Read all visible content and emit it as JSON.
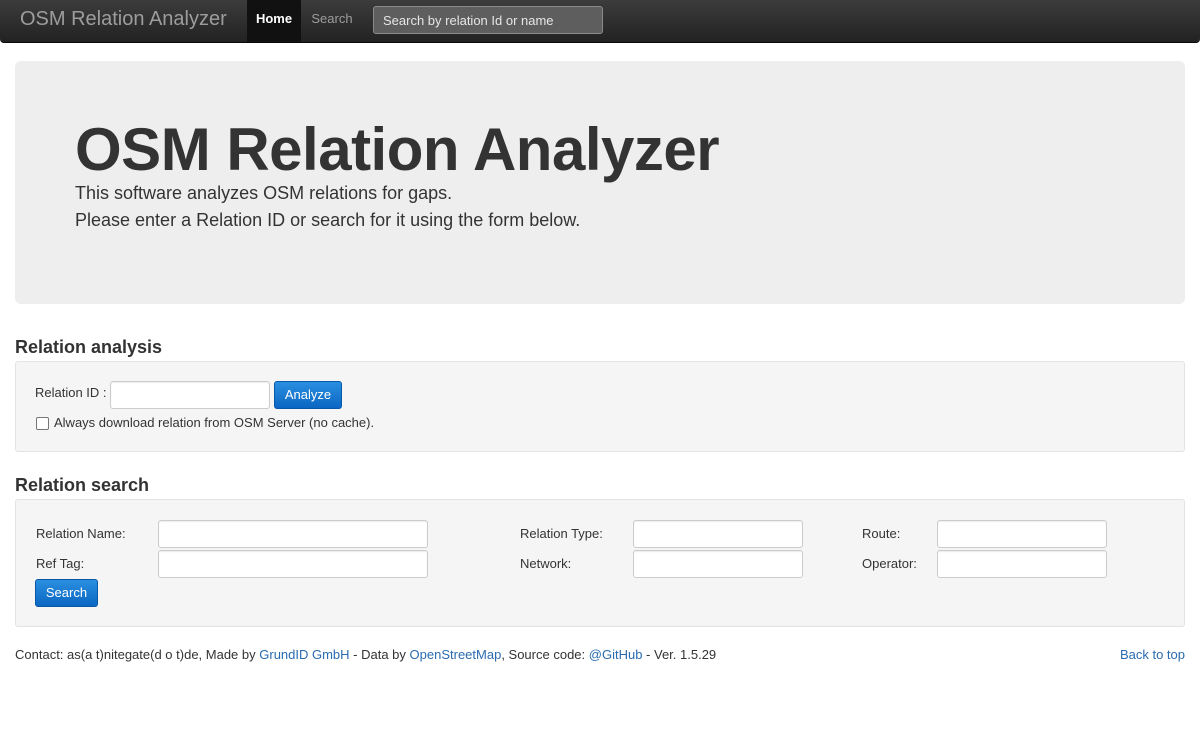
{
  "navbar": {
    "brand": "OSM Relation Analyzer",
    "home_label": "Home",
    "search_label": "Search",
    "search_placeholder": "Search by relation Id or name"
  },
  "hero": {
    "title": "OSM Relation Analyzer",
    "line1": "This software analyzes OSM relations for gaps.",
    "line2": "Please enter a Relation ID or search for it using the form below."
  },
  "analysis": {
    "heading": "Relation analysis",
    "relation_id_label": "Relation ID :",
    "relation_id_value": "",
    "analyze_button": "Analyze",
    "no_cache_checked": false,
    "no_cache_label": "Always download relation from OSM Server (no cache)."
  },
  "search": {
    "heading": "Relation search",
    "fields": {
      "relation_name": {
        "label": "Relation Name:",
        "value": ""
      },
      "ref_tag": {
        "label": "Ref Tag:",
        "value": ""
      },
      "relation_type": {
        "label": "Relation Type:",
        "value": ""
      },
      "network": {
        "label": "Network:",
        "value": ""
      },
      "route": {
        "label": "Route:",
        "value": ""
      },
      "operator": {
        "label": "Operator:",
        "value": ""
      }
    },
    "search_button": "Search"
  },
  "footer": {
    "contact_prefix": "Contact: as(a t)nitegate(d o t)de, Made by ",
    "grundid_link": "GrundID GmbH",
    "data_prefix": " - Data by ",
    "osm_link": "OpenStreetMap",
    "source_prefix": ", Source code: ",
    "github_link": "@GitHub",
    "version_text": " - Ver. 1.5.29",
    "back_to_top": "Back to top"
  },
  "colors": {
    "navbar_bg": "#222222",
    "link": "#2a6bb0",
    "primary_button": "#0a66c2",
    "hero_bg": "#eeeeee",
    "well_bg": "#f5f5f5"
  }
}
